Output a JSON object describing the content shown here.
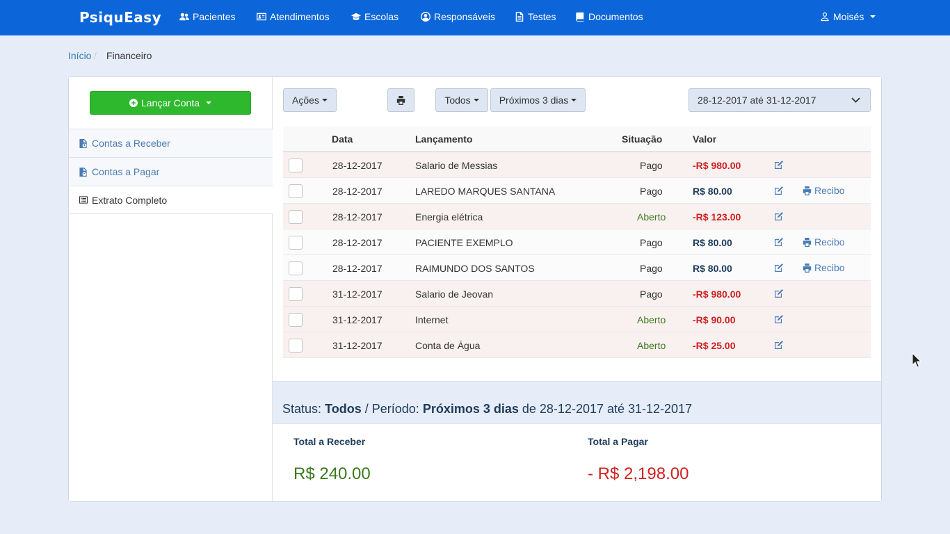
{
  "brand": "PsiquEasy",
  "nav": {
    "items": [
      {
        "label": "Pacientes",
        "icon": "users-icon"
      },
      {
        "label": "Atendimentos",
        "icon": "id-card-icon"
      },
      {
        "label": "Escolas",
        "icon": "graduation-cap-icon"
      },
      {
        "label": "Responsáveis",
        "icon": "user-circle-icon"
      },
      {
        "label": "Testes",
        "icon": "file-text-icon"
      },
      {
        "label": "Documentos",
        "icon": "book-icon"
      }
    ],
    "user": "Moisés"
  },
  "breadcrumb": {
    "home": "Início",
    "separator": "/",
    "current": "Financeiro"
  },
  "sidebar": {
    "launch_button": "Lançar Conta",
    "items": [
      {
        "label": "Contas a Receber",
        "icon": "file-receive-icon"
      },
      {
        "label": "Contas a Pagar",
        "icon": "file-pay-icon"
      },
      {
        "label": "Extrato Completo",
        "icon": "list-alt-icon",
        "active": true
      }
    ]
  },
  "toolbar": {
    "acoes": "Ações",
    "print_icon": "print-icon",
    "status_filter": "Todos",
    "period_filter": "Próximos 3 dias",
    "date_range": "28-12-2017 até 31-12-2017"
  },
  "table": {
    "headers": {
      "data": "Data",
      "lancamento": "Lançamento",
      "situacao": "Situação",
      "valor": "Valor"
    },
    "recibo_label": "Recibo",
    "rows": [
      {
        "date": "28-12-2017",
        "desc": "Salario de Messias",
        "status": "Pago",
        "value": "-R$ 980.00",
        "negative": true,
        "recibo": false
      },
      {
        "date": "28-12-2017",
        "desc": "LAREDO MARQUES SANTANA",
        "status": "Pago",
        "value": "R$ 80.00",
        "negative": false,
        "recibo": true
      },
      {
        "date": "28-12-2017",
        "desc": "Energia elétrica",
        "status": "Aberto",
        "value": "-R$ 123.00",
        "negative": true,
        "recibo": false
      },
      {
        "date": "28-12-2017",
        "desc": "PACIENTE EXEMPLO",
        "status": "Pago",
        "value": "R$ 80.00",
        "negative": false,
        "recibo": true
      },
      {
        "date": "28-12-2017",
        "desc": "RAIMUNDO DOS SANTOS",
        "status": "Pago",
        "value": "R$ 80.00",
        "negative": false,
        "recibo": true
      },
      {
        "date": "31-12-2017",
        "desc": "Salario de Jeovan",
        "status": "Pago",
        "value": "-R$ 980.00",
        "negative": true,
        "recibo": false
      },
      {
        "date": "31-12-2017",
        "desc": "Internet",
        "status": "Aberto",
        "value": "-R$ 90.00",
        "negative": true,
        "recibo": false
      },
      {
        "date": "31-12-2017",
        "desc": "Conta de Água",
        "status": "Aberto",
        "value": "-R$ 25.00",
        "negative": true,
        "recibo": false
      }
    ]
  },
  "summary": {
    "status_label": "Status:",
    "status_value": "Todos",
    "slash": "/",
    "period_label": "Período:",
    "period_value": "Próximos 3 dias",
    "range_text": "de 28-12-2017 até 31-12-2017",
    "receber_label": "Total a Receber",
    "receber_value": "R$ 240.00",
    "pagar_label": "Total a Pagar",
    "pagar_value": "- R$ 2,198.00"
  },
  "colors": {
    "navbar": "#0d66d9",
    "launch_button": "#2eb82e",
    "negative": "#d0201f",
    "open_status": "#3c7a1e",
    "link": "#337ab7"
  }
}
